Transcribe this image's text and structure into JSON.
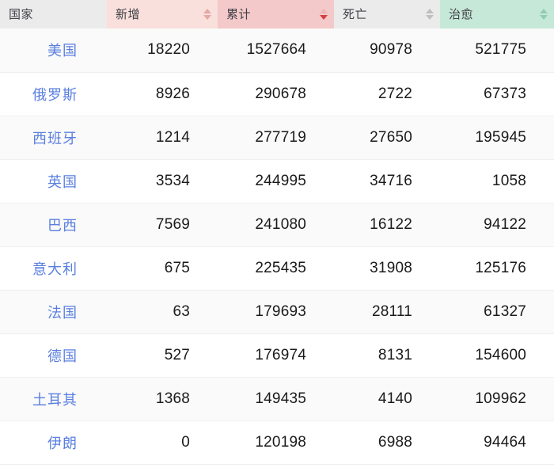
{
  "table": {
    "columns": [
      {
        "key": "country",
        "label": "国家",
        "sortable": false,
        "sort_state": "none",
        "bg": "#ebebeb"
      },
      {
        "key": "new",
        "label": "新增",
        "sortable": true,
        "sort_state": "none",
        "bg": "#f9e0dc"
      },
      {
        "key": "total",
        "label": "累计",
        "sortable": true,
        "sort_state": "descending",
        "bg": "#f3c9c9"
      },
      {
        "key": "death",
        "label": "死亡",
        "sortable": true,
        "sort_state": "none",
        "bg": "#ebebeb"
      },
      {
        "key": "cured",
        "label": "治愈",
        "sortable": true,
        "sort_state": "none",
        "bg": "#c6e8d8"
      }
    ],
    "rows": [
      {
        "country": "美国",
        "new": "18220",
        "total": "1527664",
        "death": "90978",
        "cured": "521775"
      },
      {
        "country": "俄罗斯",
        "new": "8926",
        "total": "290678",
        "death": "2722",
        "cured": "67373"
      },
      {
        "country": "西班牙",
        "new": "1214",
        "total": "277719",
        "death": "27650",
        "cured": "195945"
      },
      {
        "country": "英国",
        "new": "3534",
        "total": "244995",
        "death": "34716",
        "cured": "1058"
      },
      {
        "country": "巴西",
        "new": "7569",
        "total": "241080",
        "death": "16122",
        "cured": "94122"
      },
      {
        "country": "意大利",
        "new": "675",
        "total": "225435",
        "death": "31908",
        "cured": "125176"
      },
      {
        "country": "法国",
        "new": "63",
        "total": "179693",
        "death": "28111",
        "cured": "61327"
      },
      {
        "country": "德国",
        "new": "527",
        "total": "176974",
        "death": "8131",
        "cured": "154600"
      },
      {
        "country": "土耳其",
        "new": "1368",
        "total": "149435",
        "death": "4140",
        "cured": "109962"
      },
      {
        "country": "伊朗",
        "new": "0",
        "total": "120198",
        "death": "6988",
        "cured": "94464"
      }
    ]
  },
  "colors": {
    "header_country_bg": "#ebebeb",
    "header_new_bg": "#f9e0dc",
    "header_total_bg": "#f3c9c9",
    "header_death_bg": "#ebebeb",
    "header_cured_bg": "#c6e8d8",
    "row_odd_bg": "#fafafa",
    "row_even_bg": "#ffffff",
    "country_link": "#5a7fe0",
    "value_text": "#1a1a1a",
    "header_text": "#3f3f46",
    "active_sort_caret": "#d43f3f"
  }
}
